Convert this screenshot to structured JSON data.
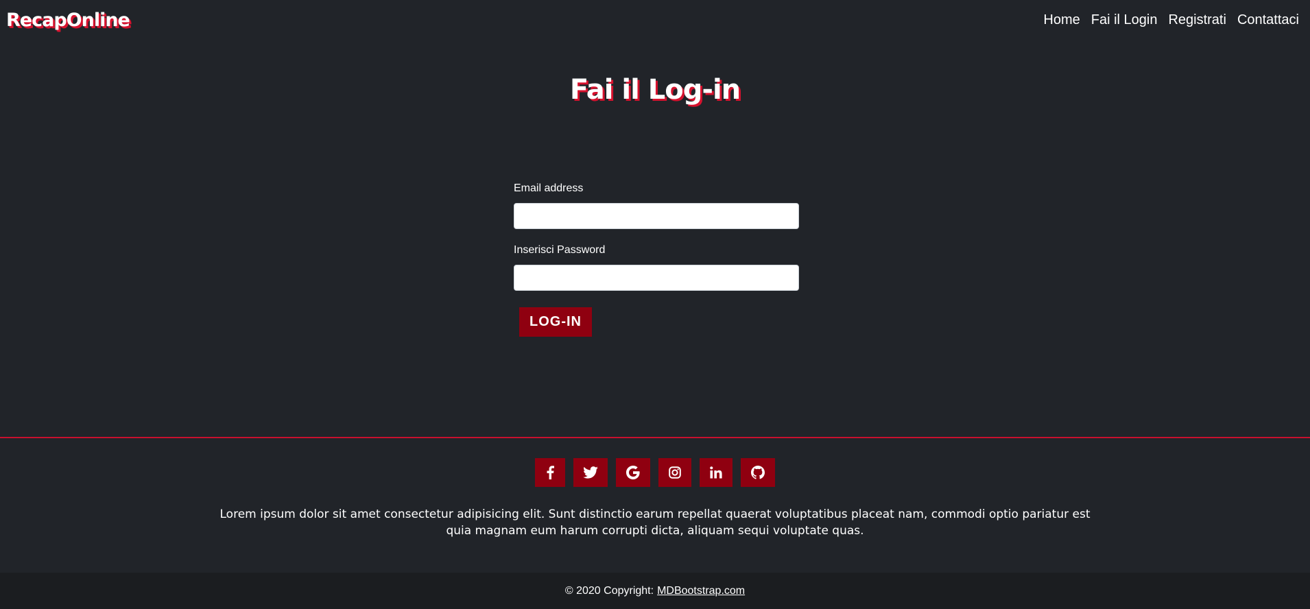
{
  "navbar": {
    "brand": "RecapOnline",
    "links": [
      {
        "label": "Home"
      },
      {
        "label": "Fai il Login"
      },
      {
        "label": "Registrati"
      },
      {
        "label": "Contattaci"
      }
    ]
  },
  "main": {
    "title": "Fai il Log-in",
    "form": {
      "email_label": "Email address",
      "email_value": "",
      "password_label": "Inserisci Password",
      "password_value": "",
      "submit_label": "LOG-IN"
    }
  },
  "footer": {
    "social_icons": [
      "facebook-icon",
      "twitter-icon",
      "google-icon",
      "instagram-icon",
      "linkedin-icon",
      "github-icon"
    ],
    "text": "Lorem ipsum dolor sit amet consectetur adipisicing elit. Sunt distinctio earum repellat quaerat voluptatibus placeat nam, commodi optio pariatur est quia magnam eum harum corrupti dicta, aliquam sequi voluptate quas.",
    "copyright_prefix": "© 2020 Copyright:",
    "copyright_link": "MDBootstrap.com"
  },
  "colors": {
    "background": "#212429",
    "accent": "#8f0010",
    "brand_shadow": "#d6122e",
    "copyright_bar": "#1b1d20"
  }
}
